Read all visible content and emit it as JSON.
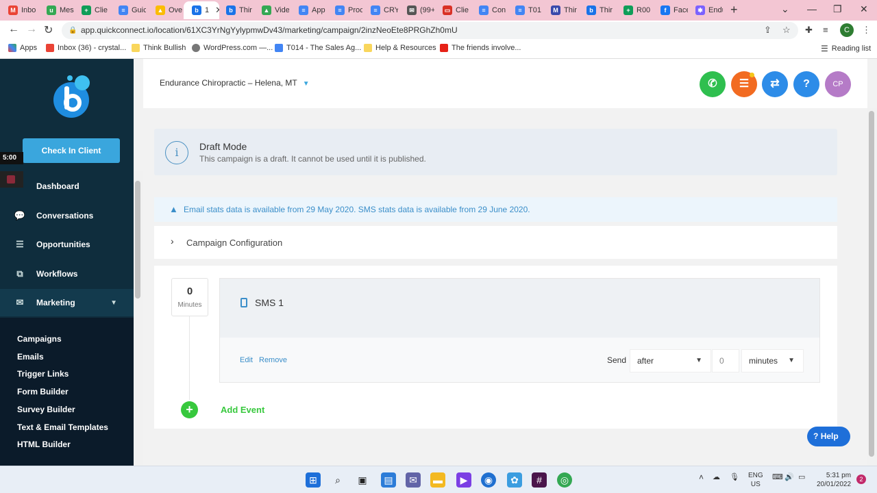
{
  "browser": {
    "tabs": [
      {
        "label": "Inbo",
        "color": "#ea4335",
        "glyph": "M"
      },
      {
        "label": "Mes",
        "color": "#34a853",
        "glyph": "u"
      },
      {
        "label": "Clie",
        "color": "#0f9d58",
        "glyph": "+"
      },
      {
        "label": "Guic",
        "color": "#4285f4",
        "glyph": "≡"
      },
      {
        "label": "Ove",
        "color": "#fbbc04",
        "glyph": "▲"
      },
      {
        "label": "1",
        "color": "#1a73e8",
        "glyph": "b"
      },
      {
        "label": "Thir",
        "color": "#1a73e8",
        "glyph": "b"
      },
      {
        "label": "Vide",
        "color": "#34a853",
        "glyph": "▲"
      },
      {
        "label": "App",
        "color": "#4285f4",
        "glyph": "≡"
      },
      {
        "label": "Proc",
        "color": "#4285f4",
        "glyph": "≡"
      },
      {
        "label": "CRY",
        "color": "#4285f4",
        "glyph": "≡"
      },
      {
        "label": "(99+",
        "color": "#555555",
        "glyph": "✉"
      },
      {
        "label": "Clie",
        "color": "#d93025",
        "glyph": "▭"
      },
      {
        "label": "Con",
        "color": "#4285f4",
        "glyph": "≡"
      },
      {
        "label": "T01",
        "color": "#4285f4",
        "glyph": "≡"
      },
      {
        "label": "Thir",
        "color": "#3949ab",
        "glyph": "M"
      },
      {
        "label": "Thir",
        "color": "#1a73e8",
        "glyph": "b"
      },
      {
        "label": "R00",
        "color": "#0f9d58",
        "glyph": "+"
      },
      {
        "label": "Face",
        "color": "#1877f2",
        "glyph": "f"
      },
      {
        "label": "Endu",
        "color": "#7b61ff",
        "glyph": "✱"
      }
    ],
    "url": "app.quickconnect.io/location/61XC3YrNgYylypmwDv43/marketing/campaign/2inzNeoEte8PRGhZh0mU",
    "bookmarks": [
      "Apps",
      "Inbox (36) - crystal...",
      "Think Bullish",
      "WordPress.com —...",
      "T014 - The Sales Ag...",
      "Help & Resources",
      "The friends involve..."
    ],
    "reading_list": "Reading list",
    "profile_initial": "C"
  },
  "sidebar": {
    "checkin_label": "Check In Client",
    "timer": "5:00",
    "nav": [
      {
        "label": "Dashboard",
        "icon": "dashboard-icon"
      },
      {
        "label": "Conversations",
        "icon": "chat-icon"
      },
      {
        "label": "Opportunities",
        "icon": "stack-icon"
      },
      {
        "label": "Workflows",
        "icon": "workflow-icon"
      },
      {
        "label": "Marketing",
        "icon": "mail-icon"
      }
    ],
    "sub": [
      "Campaigns",
      "Emails",
      "Trigger Links",
      "Form Builder",
      "Survey Builder",
      "Text & Email Templates",
      "HTML Builder"
    ]
  },
  "header": {
    "location": "Endurance Chiropractic – Helena, MT",
    "avatar": "CP",
    "colors": {
      "phone": "#2fbf4f",
      "list": "#f26b21",
      "swap": "#2d8ce8",
      "help": "#2d8ce8",
      "avatar": "#b57bc7"
    }
  },
  "main": {
    "draft_title": "Draft Mode",
    "draft_sub": "This campaign is a draft. It cannot be used until it is published.",
    "stats_msg": "Email stats data is available from 29 May 2020. SMS stats data is available from 29 June 2020.",
    "config_label": "Campaign Configuration",
    "event": {
      "delay_value": "0",
      "delay_unit": "Minutes",
      "name": "SMS 1",
      "edit": "Edit",
      "remove": "Remove",
      "send_label": "Send",
      "send_when": "after",
      "send_amount": "0",
      "send_unit": "minutes"
    },
    "add_event": "Add Event",
    "help": "Help"
  },
  "taskbar": {
    "lang_top": "ENG",
    "lang_bottom": "US",
    "time": "5:31 pm",
    "date": "20/01/2022",
    "notif": "2"
  }
}
